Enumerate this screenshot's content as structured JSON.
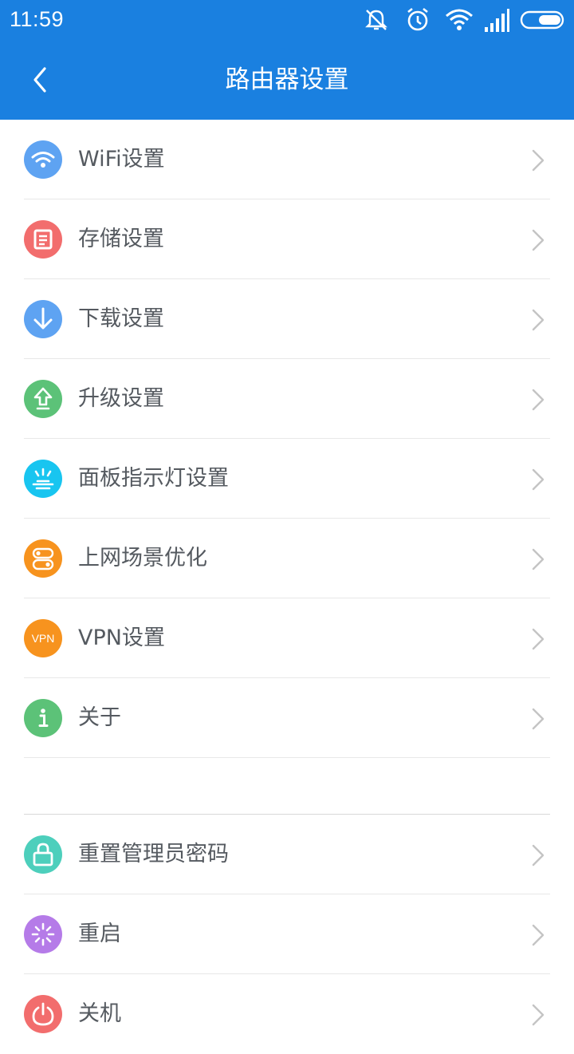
{
  "status_bar": {
    "time": "11:59",
    "icons": [
      "vibrate-off-icon",
      "alarm-icon",
      "wifi-icon",
      "signal-icon",
      "battery-icon"
    ]
  },
  "header": {
    "title": "路由器设置",
    "background": "#1a80e0"
  },
  "settings": {
    "items": [
      {
        "label": "WiFi设置",
        "icon": "wifi-icon",
        "color": "#5ea3f2"
      },
      {
        "label": "存储设置",
        "icon": "storage-icon",
        "color": "#f26d6d"
      },
      {
        "label": "下载设置",
        "icon": "download-icon",
        "color": "#5ea3f2"
      },
      {
        "label": "升级设置",
        "icon": "upgrade-icon",
        "color": "#5cc278"
      },
      {
        "label": "面板指示灯设置",
        "icon": "indicator-light-icon",
        "color": "#18c5f0"
      },
      {
        "label": "上网场景优化",
        "icon": "toggle-icon",
        "color": "#f7931e"
      },
      {
        "label": "VPN设置",
        "icon": "vpn-icon",
        "icon_text": "VPN",
        "color": "#f7931e"
      },
      {
        "label": "关于",
        "icon": "info-icon",
        "color": "#5cc278"
      }
    ],
    "system_items": [
      {
        "label": "重置管理员密码",
        "icon": "lock-icon",
        "color": "#4dcfbc"
      },
      {
        "label": "重启",
        "icon": "restart-icon",
        "color": "#b57be8"
      },
      {
        "label": "关机",
        "icon": "power-icon",
        "color": "#f26d6d"
      }
    ]
  }
}
